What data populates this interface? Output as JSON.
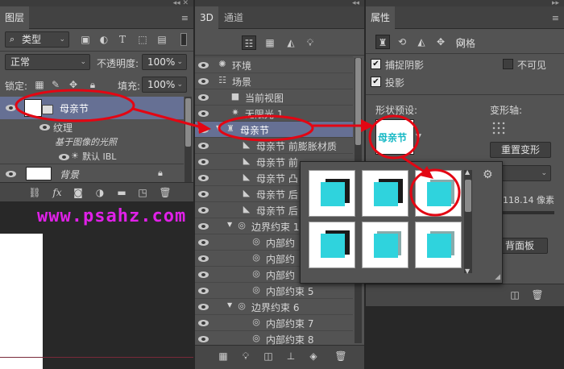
{
  "layers_panel": {
    "tab": "图层",
    "filter_kind": "类型",
    "blend_mode": "正常",
    "opacity_label": "不透明度:",
    "opacity_value": "100%",
    "lock_label": "锁定:",
    "fill_label": "填充:",
    "fill_value": "100%",
    "layers": [
      {
        "name": "母亲节",
        "selected": true
      },
      {
        "name": "纹理"
      },
      {
        "name": "基于图像的光照"
      },
      {
        "name": "默认 IBL"
      },
      {
        "name": "背景"
      }
    ]
  },
  "watermark": "www.psahz.com",
  "panel_3d": {
    "tabs": [
      "3D",
      "通道"
    ],
    "items": [
      {
        "label": "环境",
        "icon": "environment-icon"
      },
      {
        "label": "场景",
        "icon": "scene-icon"
      },
      {
        "label": "当前视图",
        "icon": "camera-icon"
      },
      {
        "label": "无限光 1",
        "icon": "light-icon"
      },
      {
        "label": "母亲节",
        "icon": "mesh-icon",
        "selected": true
      },
      {
        "label": "母亲节 前膨胀材质",
        "icon": "material-icon"
      },
      {
        "label": "母亲节 前",
        "icon": "material-icon"
      },
      {
        "label": "母亲节 凸",
        "icon": "material-icon"
      },
      {
        "label": "母亲节 后",
        "icon": "material-icon"
      },
      {
        "label": "母亲节 后",
        "icon": "material-icon"
      },
      {
        "label": "边界约束 1",
        "icon": "constraint-icon"
      },
      {
        "label": "内部约",
        "icon": "constraint-icon"
      },
      {
        "label": "内部约",
        "icon": "constraint-icon"
      },
      {
        "label": "内部约",
        "icon": "constraint-icon"
      },
      {
        "label": "内部约束 5",
        "icon": "constraint-icon"
      },
      {
        "label": "边界约束 6",
        "icon": "constraint-icon"
      },
      {
        "label": "内部约束 7",
        "icon": "constraint-icon"
      },
      {
        "label": "内部约束 8",
        "icon": "constraint-icon"
      }
    ]
  },
  "properties_panel": {
    "tab": "属性",
    "mesh_label": "网格",
    "catch_shadows": "捕捉阴影",
    "invisible": "不可见",
    "cast_shadows": "投影",
    "shape_preset_label": "形状预设:",
    "preset_thumb_text": "母亲节",
    "deform_axis_label": "变形轴:",
    "reset_deform": "重置变形",
    "value_text": "118.14 像素",
    "panel_button": "背面板"
  },
  "colors": {
    "accent_red": "#e30613",
    "watermark_color": "#e020e8",
    "preset_cyan": "#2fd3dd"
  }
}
